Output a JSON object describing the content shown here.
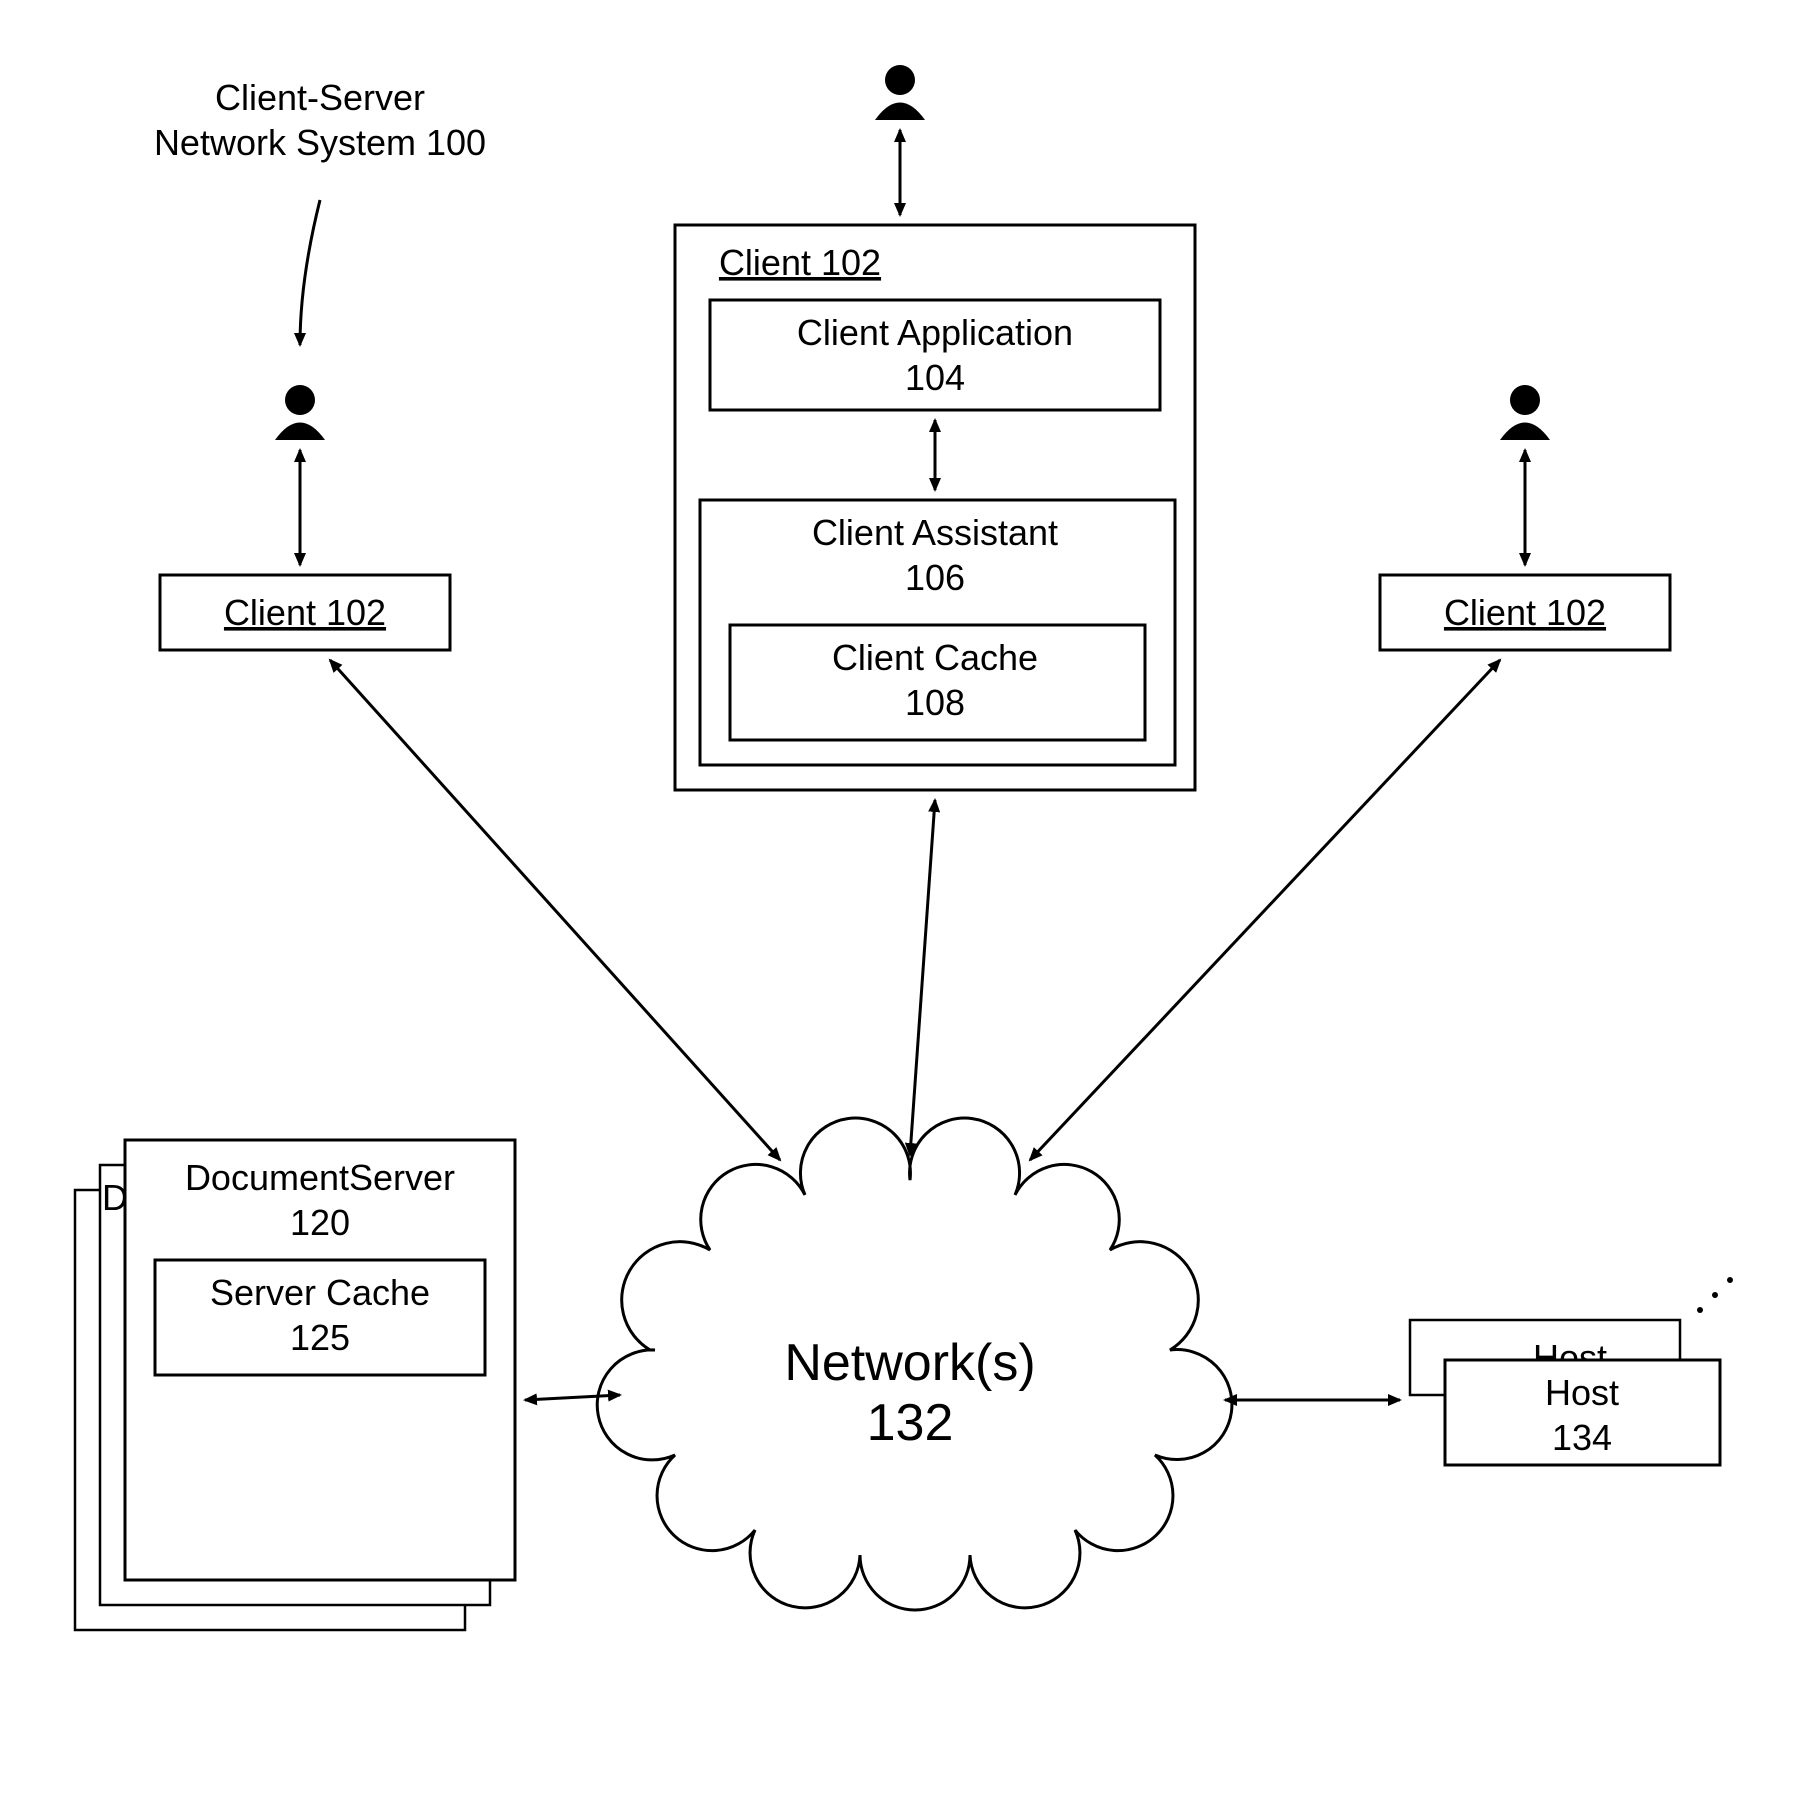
{
  "title": {
    "line1": "Client-Server",
    "line2": "Network System 100"
  },
  "clientLeft": "Client 102",
  "clientRight": "Client 102",
  "centerClient": {
    "header": "Client 102",
    "app": {
      "line1": "Client Application",
      "line2": "104"
    },
    "assistant": {
      "line1": "Client Assistant",
      "line2": "106"
    },
    "cache": {
      "line1": "Client Cache",
      "line2": "108"
    }
  },
  "docServer": {
    "back1": "D",
    "line1": "DocumentServer",
    "line2": "120",
    "cache": {
      "line1": "Server Cache",
      "line2": "125"
    }
  },
  "network": {
    "line1": "Network(s)",
    "line2": "132"
  },
  "host": {
    "back": "Host",
    "front": "Host",
    "num": "134"
  }
}
